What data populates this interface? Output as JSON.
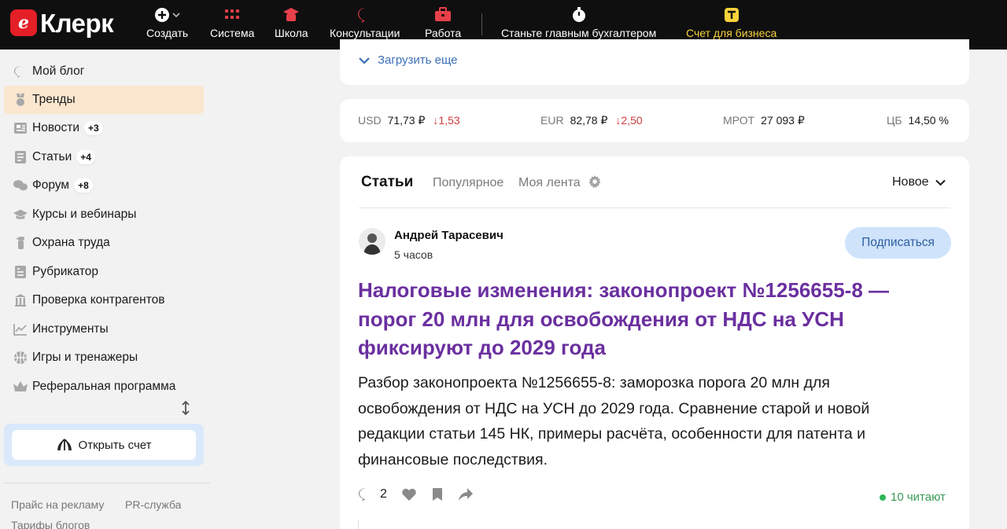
{
  "header": {
    "logo_text": "Клерк",
    "nav": [
      {
        "label": "Создать",
        "icon": "plus-circle-icon"
      },
      {
        "label": "Система",
        "icon": "grid-icon"
      },
      {
        "label": "Школа",
        "icon": "school-icon"
      },
      {
        "label": "Консультации",
        "icon": "question-bubble-icon"
      },
      {
        "label": "Работа",
        "icon": "briefcase-icon"
      },
      {
        "label": "Станьте главным бухгалтером",
        "icon": "stopwatch-icon"
      },
      {
        "label": "Счет для бизнеса",
        "icon": "bank-logo-icon"
      }
    ],
    "accent_color": "#f7d23b",
    "brand_color": "#e41f26"
  },
  "sidebar": {
    "items": [
      {
        "label": "Мой блог",
        "icon": "chat-bubble-icon"
      },
      {
        "label": "Тренды",
        "icon": "medal-icon",
        "active": true
      },
      {
        "label": "Новости",
        "icon": "newspaper-icon",
        "badge": "+3"
      },
      {
        "label": "Статьи",
        "icon": "document-icon",
        "badge": "+4"
      },
      {
        "label": "Форум",
        "icon": "chats-icon",
        "badge": "+8"
      },
      {
        "label": "Курсы и вебинары",
        "icon": "graduation-cap-icon"
      },
      {
        "label": "Охрана труда",
        "icon": "fire-extinguisher-icon"
      },
      {
        "label": "Рубрикатор",
        "icon": "catalog-icon"
      },
      {
        "label": "Проверка контрагентов",
        "icon": "building-icon"
      },
      {
        "label": "Инструменты",
        "icon": "chart-line-icon"
      },
      {
        "label": "Игры и тренажеры",
        "icon": "ball-icon"
      },
      {
        "label": "Реферальная программа",
        "icon": "crown-icon"
      }
    ],
    "open_account_label": "Открыть счет",
    "footer_links": [
      "Прайс на рекламу",
      "PR-служба",
      "Тарифы блогов"
    ]
  },
  "main": {
    "load_more_label": "Загрузить еще",
    "rates": [
      {
        "name": "USD",
        "value": "71,73 ₽",
        "change": "↓1,53"
      },
      {
        "name": "EUR",
        "value": "82,78 ₽",
        "change": "↓2,50"
      },
      {
        "name": "МРОТ",
        "value": "27 093 ₽",
        "change": ""
      },
      {
        "name": "ЦБ",
        "value": "14,50 %",
        "change": ""
      }
    ],
    "tabs": {
      "active": "Статьи",
      "popular": "Популярное",
      "feed": "Моя лента"
    },
    "sort_label": "Новое",
    "article": {
      "author": "Андрей Тарасевич",
      "time_ago": "5 часов",
      "subscribe_label": "Подписаться",
      "title": "Налоговые изменения: законопроект №1256655-8 — порог 20 млн для освобождения от НДС на УСН фиксируют до 2029 года",
      "lead": "Разбор законопроекта №1256655-8: заморозка порога 20 млн для освобождения от НДС на УСН до 2029 года. Сравнение старой и новой редакции статьи 145 НК, примеры расчёта, особенности для патента и финансовые последствия.",
      "comments_count": "2",
      "reading_now": "10 читают"
    }
  }
}
